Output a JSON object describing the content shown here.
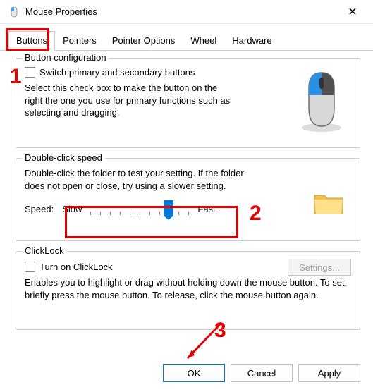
{
  "window": {
    "title": "Mouse Properties"
  },
  "tabs": {
    "items": [
      "Buttons",
      "Pointers",
      "Pointer Options",
      "Wheel",
      "Hardware"
    ],
    "active_index": 0
  },
  "button_config": {
    "legend": "Button configuration",
    "checkbox_label": "Switch primary and secondary buttons",
    "checkbox_checked": false,
    "description": "Select this check box to make the button on the right the one you use for primary functions such as selecting and dragging."
  },
  "double_click": {
    "legend": "Double-click speed",
    "description": "Double-click the folder to test your setting. If the folder does not open or close, try using a slower setting.",
    "speed_label": "Speed:",
    "slow_label": "Slow",
    "fast_label": "Fast",
    "slider_value": 8,
    "slider_min": 0,
    "slider_max": 10
  },
  "clicklock": {
    "legend": "ClickLock",
    "checkbox_label": "Turn on ClickLock",
    "checkbox_checked": false,
    "settings_label": "Settings...",
    "settings_enabled": false,
    "description": "Enables you to highlight or drag without holding down the mouse button. To set, briefly press the mouse button. To release, click the mouse button again."
  },
  "footer": {
    "ok": "OK",
    "cancel": "Cancel",
    "apply": "Apply"
  },
  "annotations": {
    "n1": "1",
    "n2": "2",
    "n3": "3"
  }
}
